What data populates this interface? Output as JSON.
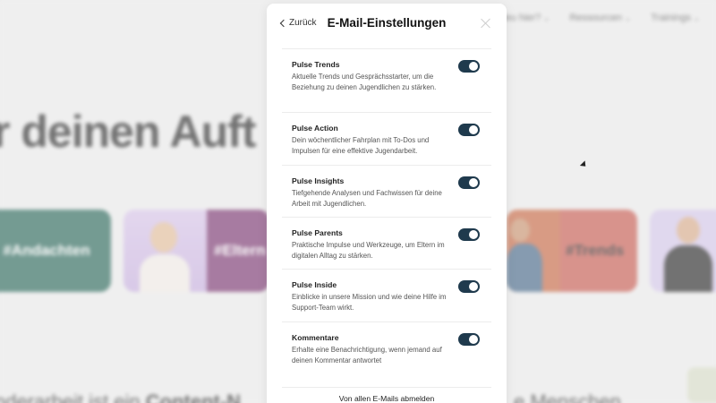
{
  "background": {
    "nav": [
      "Neu hier?",
      "Ressourcen",
      "Trainings"
    ],
    "hero_text": "r deinen Auft",
    "tiles": [
      "#Andachten",
      "#Eltern",
      "#Trends"
    ],
    "bottom_text_left": "nderarbeit ist ein ",
    "bottom_text_bold": "Content-N",
    "bottom_text_right": "e Menschen"
  },
  "modal": {
    "back_label": "Zurück",
    "title": "E-Mail-Einstellungen",
    "items": [
      {
        "title": "Pulse Trends",
        "desc": "Aktuelle Trends und Gesprächsstarter, um die Beziehung zu deinen Jugendlichen zu stärken.",
        "enabled": true
      },
      {
        "title": "Pulse Action",
        "desc": "Dein wöchentlicher Fahrplan mit To-Dos und Impulsen für eine effektive Jugendarbeit.",
        "enabled": true
      },
      {
        "title": "Pulse Insights",
        "desc": "Tiefgehende Analysen und Fachwissen für deine Arbeit mit Jugendlichen.",
        "enabled": true
      },
      {
        "title": "Pulse Parents",
        "desc": "Praktische Impulse und Werkzeuge, um Eltern im digitalen Alltag zu stärken.",
        "enabled": true
      },
      {
        "title": "Pulse Inside",
        "desc": "Einblicke in unsere Mission und wie deine Hilfe im Support-Team wirkt.",
        "enabled": true
      },
      {
        "title": "Kommentare",
        "desc": "Erhalte eine Benachrichtigung, wenn jemand auf deinen Kommentar antwortet",
        "enabled": true
      }
    ],
    "unsubscribe_label": "Von allen E-Mails abmelden"
  },
  "colors": {
    "toggle_on": "#1f3a4d",
    "tile_andachten": "#2f6a5d",
    "tile_eltern": "#7d3a73",
    "tile_trends": "#c85e54"
  }
}
